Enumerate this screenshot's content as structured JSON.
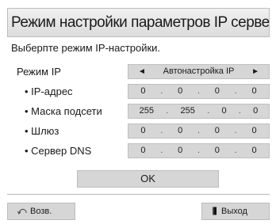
{
  "dialog": {
    "title": "Режим настройки параметров IP сервера",
    "subtitle": "Выберпте режим IP-настройки."
  },
  "mode": {
    "label": "Режим IP",
    "value": "Автонастройка IP",
    "left_arrow": "◄",
    "right_arrow": "►"
  },
  "fields": [
    {
      "label": "• IP-адрес",
      "octets": [
        "0",
        "0",
        "0",
        "0"
      ]
    },
    {
      "label": "• Маска подсети",
      "octets": [
        "255",
        "255",
        "0",
        "0"
      ]
    },
    {
      "label": "• Шлюз",
      "octets": [
        "0",
        "0",
        "0",
        "0"
      ]
    },
    {
      "label": "• Сервер DNS",
      "octets": [
        "0",
        "0",
        "0",
        "0"
      ]
    }
  ],
  "ok_label": "OK",
  "footer": {
    "back_label": "Возв.",
    "back_icon": "return-icon",
    "exit_label": "Выход",
    "exit_icon": "exit-icon"
  }
}
